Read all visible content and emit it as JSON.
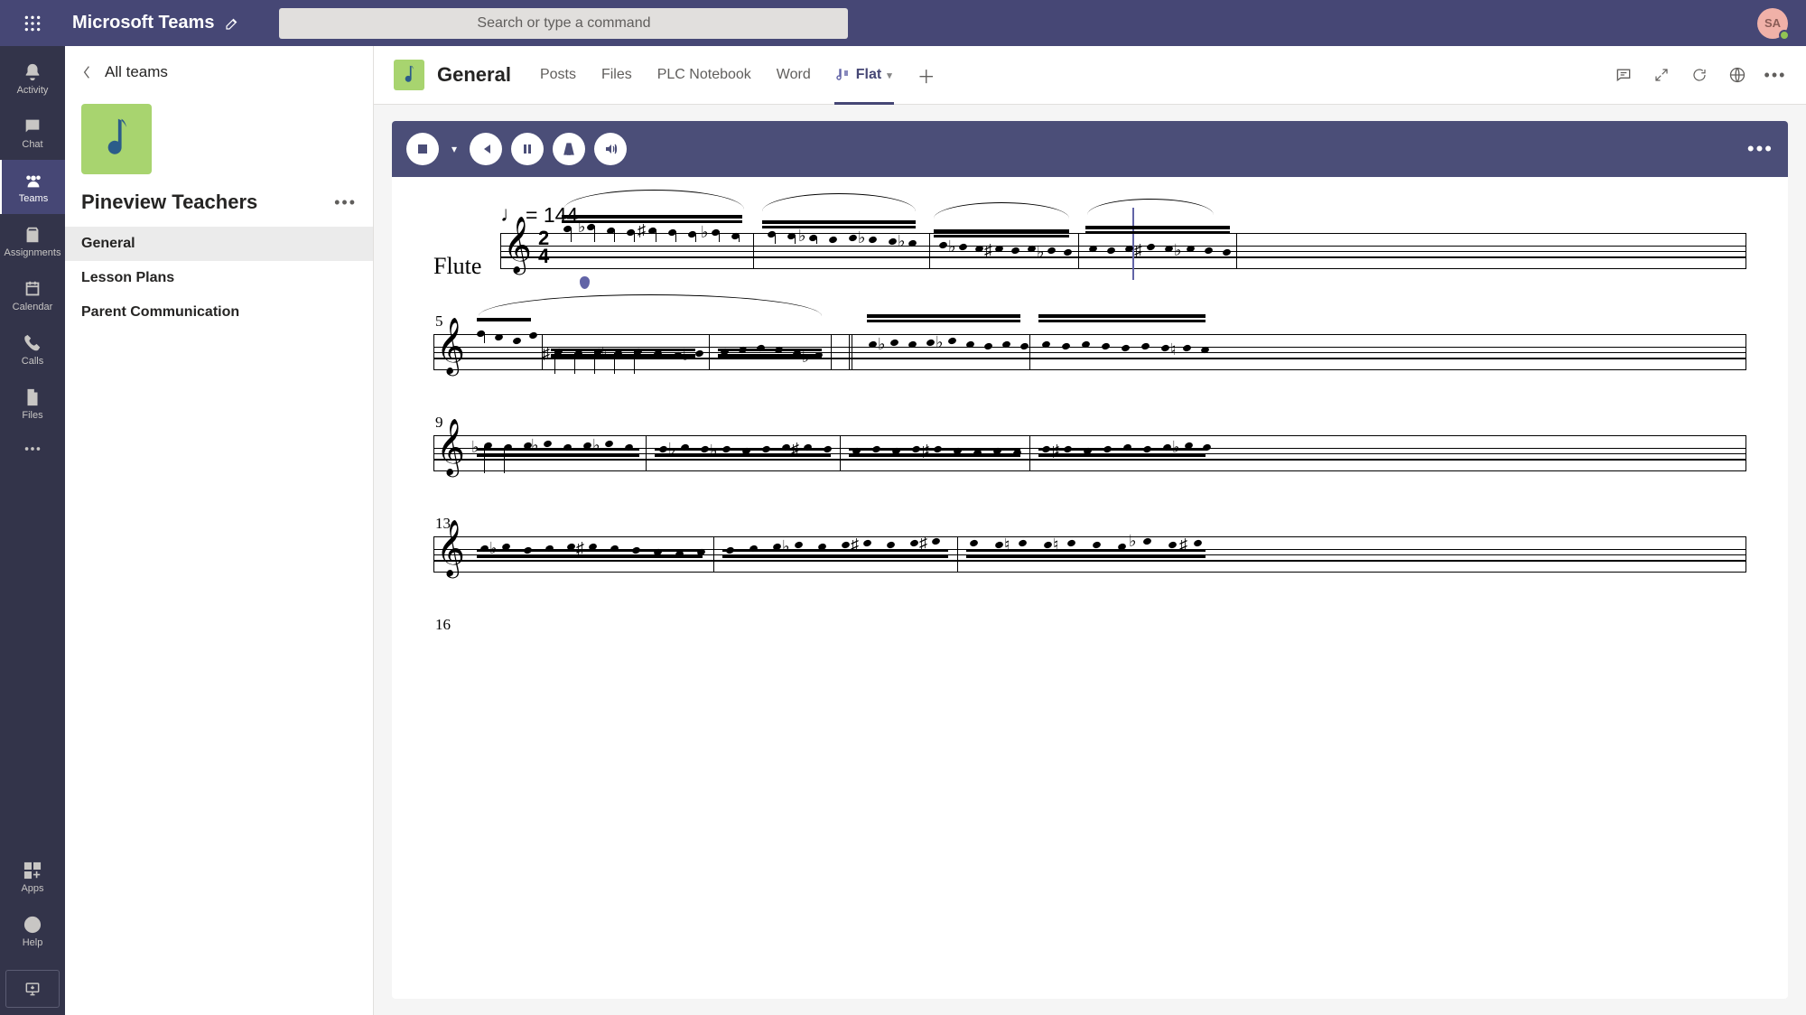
{
  "app": {
    "title": "Microsoft Teams"
  },
  "search": {
    "placeholder": "Search or type a command"
  },
  "user": {
    "initials": "SA"
  },
  "rail": {
    "items": [
      {
        "id": "activity",
        "label": "Activity"
      },
      {
        "id": "chat",
        "label": "Chat"
      },
      {
        "id": "teams",
        "label": "Teams",
        "active": true
      },
      {
        "id": "assignments",
        "label": "Assignments"
      },
      {
        "id": "calendar",
        "label": "Calendar"
      },
      {
        "id": "calls",
        "label": "Calls"
      },
      {
        "id": "files",
        "label": "Files"
      }
    ],
    "apps_label": "Apps",
    "help_label": "Help"
  },
  "sidebar": {
    "back_label": "All teams",
    "team_name": "Pineview Teachers",
    "channels": [
      {
        "label": "General",
        "active": true
      },
      {
        "label": "Lesson Plans"
      },
      {
        "label": "Parent Communication"
      }
    ]
  },
  "header": {
    "channel_title": "General",
    "tabs": [
      {
        "label": "Posts"
      },
      {
        "label": "Files"
      },
      {
        "label": "PLC Notebook"
      },
      {
        "label": "Word"
      },
      {
        "label": "Flat",
        "active": true,
        "has_icon": true
      }
    ]
  },
  "flat": {
    "tempo_marking": "= 144",
    "instrument": "Flute",
    "time_signature": {
      "top": "2",
      "bottom": "4"
    },
    "systems": [
      {
        "measure_number": "",
        "first": true
      },
      {
        "measure_number": "5"
      },
      {
        "measure_number": "9"
      },
      {
        "measure_number": "13"
      },
      {
        "measure_number": "16"
      }
    ]
  }
}
